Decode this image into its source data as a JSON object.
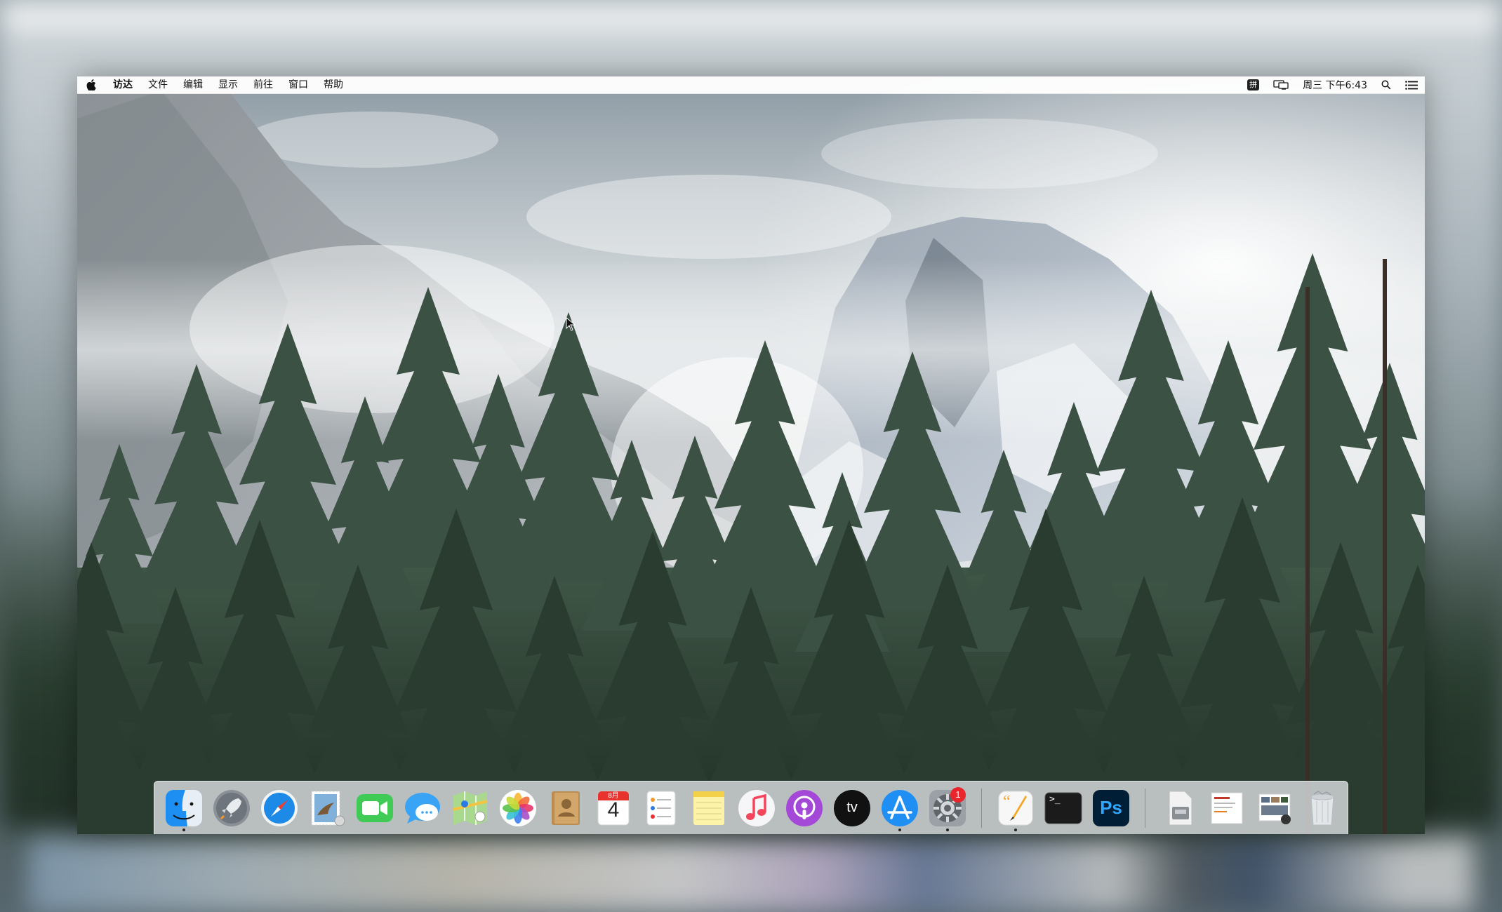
{
  "menubar": {
    "app_name": "访达",
    "menus": [
      "文件",
      "编辑",
      "显示",
      "前往",
      "窗口",
      "帮助"
    ],
    "input_method": "拼",
    "clock": "周三 下午6:43"
  },
  "dock": {
    "items": [
      {
        "name": "finder",
        "icon": "finder-icon",
        "running": true
      },
      {
        "name": "launchpad",
        "icon": "rocket-icon",
        "running": false
      },
      {
        "name": "safari",
        "icon": "compass-icon",
        "running": false
      },
      {
        "name": "mail",
        "icon": "stamp-eagle-icon",
        "running": false
      },
      {
        "name": "facetime",
        "icon": "video-camera-icon",
        "running": false
      },
      {
        "name": "messages",
        "icon": "speech-bubble-icon",
        "running": false
      },
      {
        "name": "maps",
        "icon": "map-icon",
        "running": false
      },
      {
        "name": "photos",
        "icon": "flower-icon",
        "running": false
      },
      {
        "name": "contacts",
        "icon": "address-book-icon",
        "running": false
      },
      {
        "name": "calendar",
        "icon": "calendar-icon",
        "running": false
      },
      {
        "name": "reminders",
        "icon": "checklist-icon",
        "running": false
      },
      {
        "name": "notes",
        "icon": "notepad-icon",
        "running": false
      },
      {
        "name": "music",
        "icon": "music-note-icon",
        "running": false
      },
      {
        "name": "podcasts",
        "icon": "podcast-icon",
        "running": false
      },
      {
        "name": "tv",
        "icon": "apple-tv-icon",
        "running": false
      },
      {
        "name": "app-store",
        "icon": "app-store-icon",
        "running": true
      },
      {
        "name": "system-preferences",
        "icon": "gear-icon",
        "running": true
      }
    ],
    "calendar": {
      "month": "8月",
      "day": "4"
    },
    "system_prefs_badge": "1",
    "tv_label": "tv",
    "ps_label": "Ps",
    "terminal_prompt": ">_"
  }
}
